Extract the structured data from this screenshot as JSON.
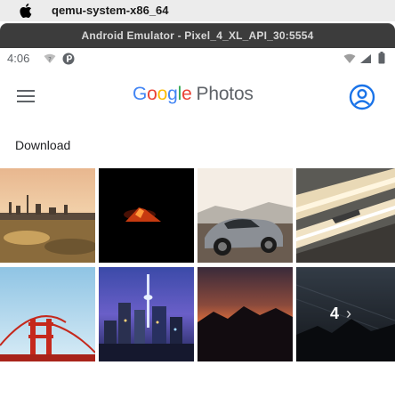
{
  "mac_menubar": {
    "app_name": "qemu-system-x86_64"
  },
  "window": {
    "title": "Android Emulator - Pixel_4_XL_API_30:5554"
  },
  "status_bar": {
    "time": "4:06"
  },
  "app_bar": {
    "logo_google": [
      "G",
      "o",
      "o",
      "g",
      "l",
      "e"
    ],
    "logo_photos": "Photos"
  },
  "section": {
    "title": "Download"
  },
  "photos": [
    {
      "subject": "city skyline at sunset by water"
    },
    {
      "subject": "volcano erupting at night"
    },
    {
      "subject": "silver sports car"
    },
    {
      "subject": "light trails on highway"
    },
    {
      "subject": "red suspension bridge"
    },
    {
      "subject": "illuminated city at night with tower"
    },
    {
      "subject": "mountains at sunset"
    },
    {
      "subject": "mountain under starry sky"
    }
  ],
  "more_count": "4",
  "colors": {
    "accent": "#1a73e8",
    "icon_grey": "#5f6368"
  }
}
